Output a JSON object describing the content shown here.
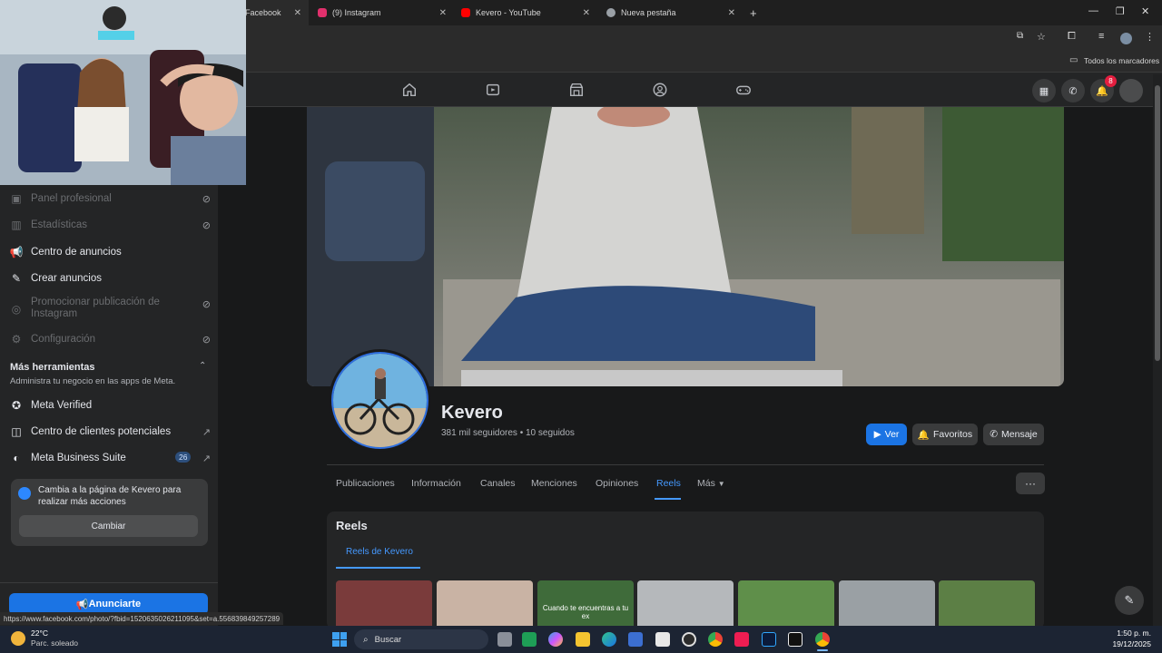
{
  "browser": {
    "tabs": [
      {
        "title": "Facebook",
        "favicon_color": "#1877f2",
        "active": true
      },
      {
        "title": "(9) Instagram",
        "favicon_color": "#e1306c",
        "active": false
      },
      {
        "title": "Kevero - YouTube",
        "favicon_color": "#ff0000",
        "active": false
      },
      {
        "title": "Nueva pestaña",
        "favicon_color": "#9aa0a6",
        "active": false
      }
    ],
    "new_tab": "+",
    "close_glyph": "✕",
    "bookmarks_label": "Todos los marcadores",
    "status_url": "https://www.facebook.com/photo/?fbid=1520635026211095&set=a.556839849257289"
  },
  "fb_nav": {
    "icons": [
      "home-icon",
      "video-icon",
      "marketplace-icon",
      "groups-icon",
      "gaming-icon"
    ],
    "notifications_count": "8"
  },
  "sidebar": {
    "items": [
      {
        "label": "Panel profesional",
        "icon": "panel-icon",
        "dim": true,
        "trail": "⊘"
      },
      {
        "label": "Estadísticas",
        "icon": "stats-icon",
        "dim": true,
        "trail": "⊘"
      },
      {
        "label": "Centro de anuncios",
        "icon": "megaphone-icon",
        "dim": false,
        "trail": ""
      },
      {
        "label": "Crear anuncios",
        "icon": "pencil-icon",
        "dim": false,
        "trail": ""
      },
      {
        "label": "Promocionar publicación de Instagram",
        "icon": "instagram-icon",
        "dim": true,
        "trail": "⊘"
      },
      {
        "label": "Configuración",
        "icon": "gear-icon",
        "dim": true,
        "trail": "⊘"
      }
    ],
    "tools_heading": "Más herramientas",
    "tools_sub": "Administra tu negocio en las apps de Meta.",
    "tools": [
      {
        "label": "Meta Verified",
        "icon": "verified-icon",
        "trail": ""
      },
      {
        "label": "Centro de clientes potenciales",
        "icon": "leads-icon",
        "trail": "↗"
      },
      {
        "label": "Meta Business Suite",
        "icon": "business-suite-icon",
        "badge": "26",
        "trail": "↗"
      }
    ],
    "notice_text": "Cambia a la página de Kevero para realizar más acciones",
    "notice_button": "Cambiar",
    "cta": "Anunciarte"
  },
  "profile": {
    "name": "Kevero",
    "stats": "381 mil seguidores • 10 seguidos",
    "buttons": {
      "watch": "Ver",
      "favorites": "Favoritos",
      "message": "Mensaje"
    },
    "tabs": [
      "Publicaciones",
      "Información",
      "Canales",
      "Menciones",
      "Opiniones",
      "Reels",
      "Más"
    ],
    "active_tab": "Reels",
    "more_glyph": "···"
  },
  "reels": {
    "heading": "Reels",
    "subtab": "Reels de Kevero",
    "thumb_caption": "Cuando te encuentras a tu ex",
    "thumb_colors": [
      "#7a3b3b",
      "#c9b3a4",
      "#3f6b3a",
      "#b5b8bb",
      "#5f8f4a",
      "#9aa0a4",
      "#5c7f45"
    ]
  },
  "taskbar": {
    "weather_temp": "22°C",
    "weather_desc": "Parc. soleado",
    "search": "Buscar",
    "time": "1:50 p. m.",
    "date": "19/12/2025",
    "apps": [
      "start-icon",
      "search-icon",
      "taskview-icon",
      "sheets-icon",
      "copilot-icon",
      "explorer-icon",
      "edge-icon",
      "store-icon",
      "notes-icon",
      "obs-icon",
      "chrome-icon",
      "tiktok-icon",
      "photoshop-icon",
      "capcut-icon",
      "chrome-active-icon"
    ]
  }
}
